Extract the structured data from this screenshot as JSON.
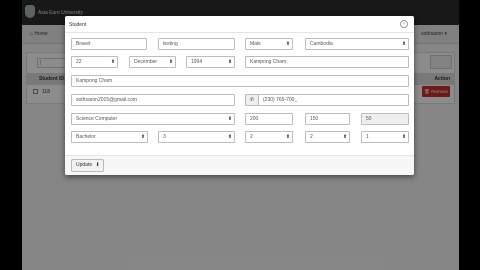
{
  "app": {
    "brand": "Asia Euro University"
  },
  "nav": {
    "home": "Home",
    "user": "sothsaron"
  },
  "list": {
    "search_placeholder": "|",
    "col_id": "Student ID",
    "col_action": "Action",
    "rows": [
      {
        "id": "118"
      }
    ],
    "remove_label": "Remove"
  },
  "modal": {
    "title": "Student",
    "close": "×",
    "first_name": "Bravet",
    "last_name": "testing",
    "gender": "Male",
    "country": "Cambodia",
    "dob_day": "22",
    "dob_month": "December",
    "dob_year": "1994",
    "birth_place": "Kampong Cham",
    "address": "Kampong Cham",
    "email": "sothsaron2015@gmail.com",
    "phone_icon": "✆",
    "phone": "(230) 765-700_",
    "major": "Science Computer",
    "fee_1": "200",
    "fee_2": "150",
    "fee_3": "50",
    "degree": "Bachelor",
    "year": "3",
    "semester": "2",
    "shift": "2",
    "batch": "1",
    "update_label": "Update",
    "update_icon": "⬇"
  }
}
